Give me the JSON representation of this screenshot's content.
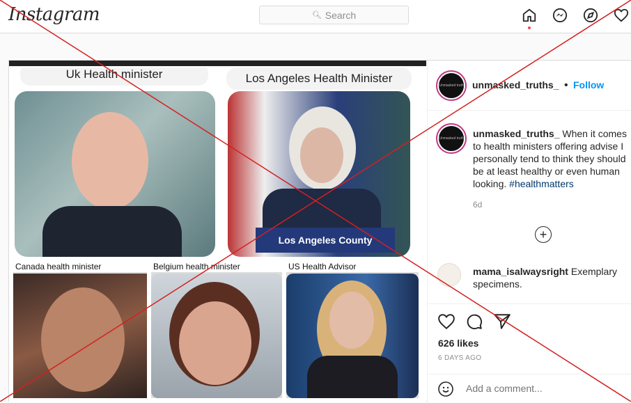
{
  "header": {
    "logo": "Instagram",
    "search_placeholder": "Search",
    "icons": [
      "home-icon",
      "messenger-icon",
      "explore-icon",
      "activity-heart-icon"
    ]
  },
  "media": {
    "panels": [
      {
        "label": "Uk Health minister"
      },
      {
        "label": "Los Angeles Health Minister"
      },
      {
        "label": "Canada health minister"
      },
      {
        "label": "Belgium health minister"
      },
      {
        "label": "US Health Advisor"
      }
    ],
    "sign_text": "Los Angeles County"
  },
  "post": {
    "username": "unmasked_truths_",
    "avatar_text": "Unmasked truth",
    "follow_sep": "•",
    "follow_label": "Follow",
    "caption_user": "unmasked_truths_",
    "caption_text": " When it comes to health ministers offering advise I personally tend to think they should be at least healthy or even human looking. ",
    "hashtag": "#healthmatters",
    "time": "6d",
    "comment_user": "mama_isalwaysright",
    "comment_text": " Exemplary specimens.",
    "likes": "626 likes",
    "ago": "6 DAYS AGO",
    "add_comment_placeholder": "Add a comment..."
  },
  "colors": {
    "link": "#0095f6",
    "hashtag": "#00376b",
    "overlay_x": "#d42020"
  }
}
